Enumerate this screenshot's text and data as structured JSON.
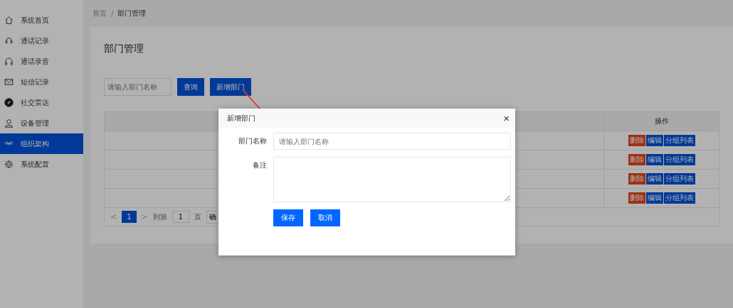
{
  "sidebar": {
    "items": [
      {
        "label": "系统首页",
        "kind": "home",
        "selected": false
      },
      {
        "label": "通话记录",
        "kind": "phone",
        "selected": false
      },
      {
        "label": "通话录音",
        "kind": "headphones",
        "selected": false
      },
      {
        "label": "短信记录",
        "kind": "mail",
        "selected": false
      },
      {
        "label": "社交雷达",
        "kind": "compass",
        "selected": false
      },
      {
        "label": "设备管理",
        "kind": "user",
        "selected": false
      },
      {
        "label": "组织架构",
        "kind": "org",
        "selected": true
      },
      {
        "label": "系统配置",
        "kind": "gear",
        "selected": false
      }
    ]
  },
  "breadcrumb": [
    "首页",
    "部门管理"
  ],
  "breadcrumb_separator": "/",
  "page_title": "部门管理",
  "search": {
    "placeholder": "请输入部门名称"
  },
  "toolbar_buttons": [
    "查询",
    "新增部门"
  ],
  "table": {
    "columns": [
      "操作"
    ],
    "rows": [
      {
        "actions": [
          "删除",
          "编辑",
          "分组列表"
        ]
      },
      {
        "actions": [
          "删除",
          "编辑",
          "分组列表"
        ]
      },
      {
        "actions": [
          "删除",
          "编辑",
          "分组列表"
        ]
      },
      {
        "actions": [
          "删除",
          "编辑",
          "分组列表"
        ]
      }
    ]
  },
  "pagination": {
    "prev": "<",
    "pages": [
      {
        "label": "1",
        "selected": true
      }
    ],
    "next": ">",
    "goto_label": "到第",
    "goto_value": "1",
    "page_unit": "页",
    "confirm": "确"
  },
  "dialog": {
    "title": "新增部门",
    "close": "×",
    "fields": [
      {
        "kind": "input",
        "label": "部门名称",
        "placeholder": "请输入部门名称"
      },
      {
        "kind": "textarea",
        "label": "备注"
      }
    ],
    "buttons": [
      "保存",
      "取消"
    ]
  }
}
